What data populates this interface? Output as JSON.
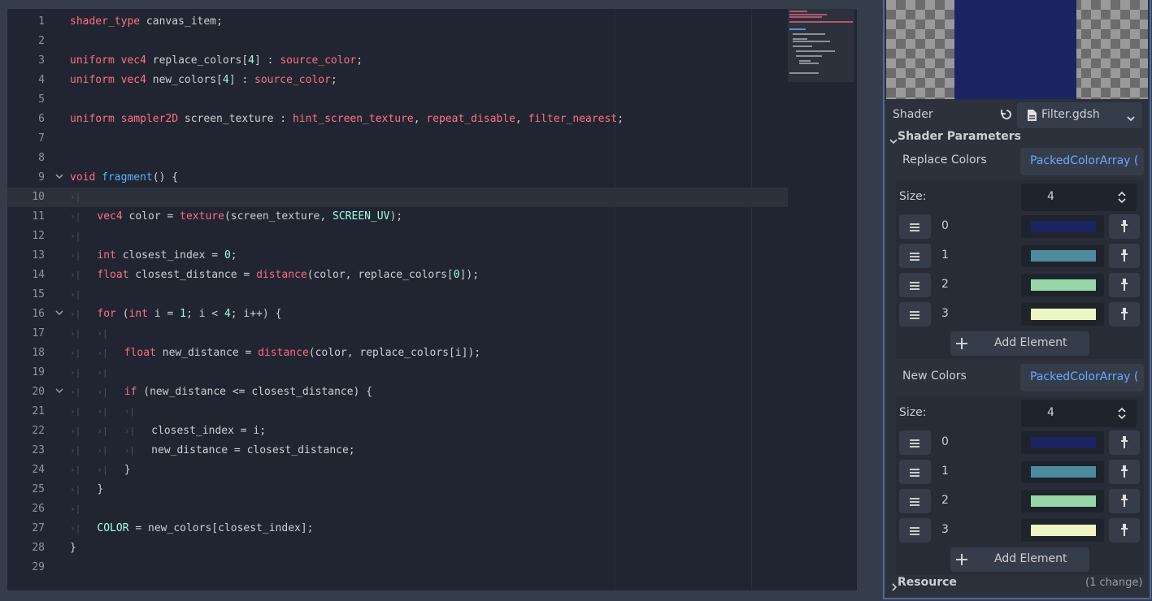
{
  "editor": {
    "lines": [
      {
        "n": "1",
        "tabs": 0,
        "html": "<span class='k'>shader_type</span> canvas_item;"
      },
      {
        "n": "2",
        "tabs": 0,
        "html": ""
      },
      {
        "n": "3",
        "tabs": 0,
        "html": "<span class='k'>uniform</span> <span class='ty'>vec4</span> replace_colors[<span class='n'>4</span>] : <span class='k'>source_color</span>;"
      },
      {
        "n": "4",
        "tabs": 0,
        "html": "<span class='k'>uniform</span> <span class='ty'>vec4</span> new_colors[<span class='n'>4</span>] : <span class='k'>source_color</span>;"
      },
      {
        "n": "5",
        "tabs": 0,
        "html": ""
      },
      {
        "n": "6",
        "tabs": 0,
        "html": "<span class='k'>uniform</span> <span class='ty'>sampler2D</span> screen_texture : <span class='k'>hint_screen_texture</span>, <span class='k'>repeat_disable</span>, <span class='k'>filter_nearest</span>;"
      },
      {
        "n": "7",
        "tabs": 0,
        "html": ""
      },
      {
        "n": "8",
        "tabs": 0,
        "html": ""
      },
      {
        "n": "9",
        "tabs": 0,
        "fold": true,
        "html": "<span class='ty'>void</span> <span class='f'>fragment</span>() {"
      },
      {
        "n": "10",
        "tabs": 1,
        "current": true,
        "html": ""
      },
      {
        "n": "11",
        "tabs": 1,
        "html": "<span class='ty'>vec4</span> color = <span class='b'>texture</span>(screen_texture, <span class='n'>SCREEN_UV</span>);"
      },
      {
        "n": "12",
        "tabs": 1,
        "html": ""
      },
      {
        "n": "13",
        "tabs": 1,
        "html": "<span class='ty'>int</span> closest_index = <span class='n'>0</span>;"
      },
      {
        "n": "14",
        "tabs": 1,
        "html": "<span class='ty'>float</span> closest_distance = <span class='b'>distance</span>(color, replace_colors[<span class='n'>0</span>]);"
      },
      {
        "n": "15",
        "tabs": 1,
        "html": ""
      },
      {
        "n": "16",
        "tabs": 1,
        "fold": true,
        "html": "<span class='k'>for</span> (<span class='ty'>int</span> i = <span class='n'>1</span>; i &lt; <span class='n'>4</span>; i++) {"
      },
      {
        "n": "17",
        "tabs": 2,
        "html": ""
      },
      {
        "n": "18",
        "tabs": 2,
        "html": "<span class='ty'>float</span> new_distance = <span class='b'>distance</span>(color, replace_colors[i]);"
      },
      {
        "n": "19",
        "tabs": 2,
        "html": ""
      },
      {
        "n": "20",
        "tabs": 2,
        "fold": true,
        "html": "<span class='k'>if</span> (new_distance &lt;= closest_distance) {"
      },
      {
        "n": "21",
        "tabs": 3,
        "html": ""
      },
      {
        "n": "22",
        "tabs": 3,
        "html": "closest_index = i;"
      },
      {
        "n": "23",
        "tabs": 3,
        "html": "new_distance = closest_distance;"
      },
      {
        "n": "24",
        "tabs": 2,
        "html": "}"
      },
      {
        "n": "25",
        "tabs": 1,
        "html": "}"
      },
      {
        "n": "26",
        "tabs": 1,
        "html": ""
      },
      {
        "n": "27",
        "tabs": 1,
        "html": "<span class='n'>COLOR</span> = new_colors[closest_index];"
      },
      {
        "n": "28",
        "tabs": 0,
        "html": "}"
      },
      {
        "n": "29",
        "tabs": 0,
        "html": ""
      }
    ]
  },
  "inspector": {
    "shader_label": "Shader",
    "shader_file": "Filter.gdsh",
    "shader_params_label": "Shader Parameters",
    "replace_colors": {
      "label": "Replace Colors",
      "type": "PackedColorArray (",
      "size_label": "Size:",
      "size": "4",
      "items": [
        {
          "index": "0",
          "color": "#1c2464"
        },
        {
          "index": "1",
          "color": "#4d8ba0"
        },
        {
          "index": "2",
          "color": "#96d6a8"
        },
        {
          "index": "3",
          "color": "#eef6c4"
        }
      ],
      "add_label": "Add Element"
    },
    "new_colors": {
      "label": "New Colors",
      "type": "PackedColorArray (",
      "size_label": "Size:",
      "size": "4",
      "items": [
        {
          "index": "0",
          "color": "#1c2464"
        },
        {
          "index": "1",
          "color": "#4d8ba0"
        },
        {
          "index": "2",
          "color": "#96d6a8"
        },
        {
          "index": "3",
          "color": "#eef6c4"
        }
      ],
      "add_label": "Add Element"
    },
    "resource_label": "Resource",
    "resource_changes": "(1 change)"
  }
}
